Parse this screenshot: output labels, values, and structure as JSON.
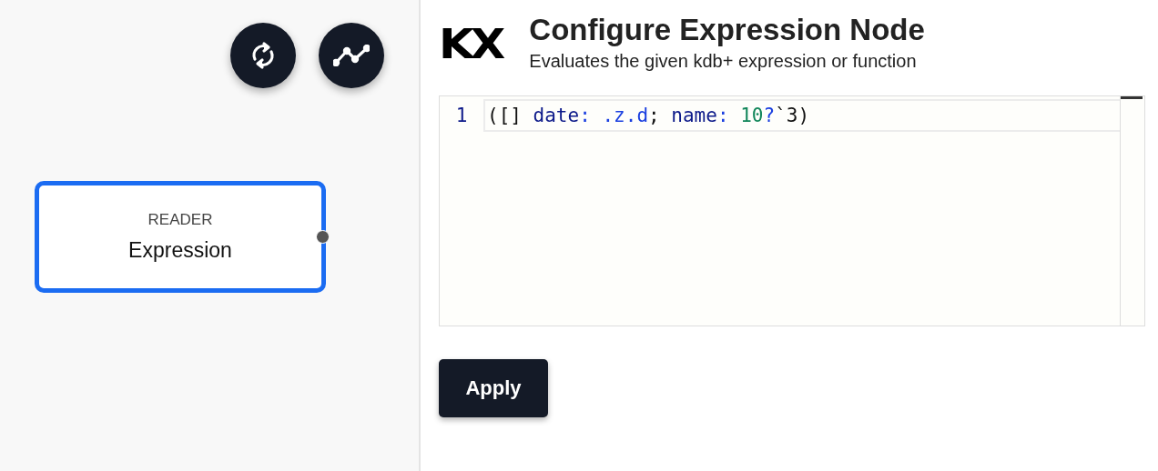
{
  "canvas": {
    "toolbar": [
      {
        "kind": "refresh"
      },
      {
        "kind": "chart"
      }
    ],
    "node": {
      "category": "READER",
      "name": "Expression",
      "selected": true
    }
  },
  "panel": {
    "logo": "KX",
    "title": "Configure Expression Node",
    "subtitle": "Evaluates the given kdb+ expression or function",
    "editor": {
      "lines": [
        {
          "number": "1",
          "tokens": [
            {
              "kind": "plain",
              "text": "([] "
            },
            {
              "kind": "keyword",
              "text": "date"
            },
            {
              "kind": "operator",
              "text": ": "
            },
            {
              "kind": "builtin",
              "text": ".z.d"
            },
            {
              "kind": "plain",
              "text": "; "
            },
            {
              "kind": "keyword",
              "text": "name"
            },
            {
              "kind": "operator",
              "text": ": "
            },
            {
              "kind": "number",
              "text": "10"
            },
            {
              "kind": "operator",
              "text": "?"
            },
            {
              "kind": "plain",
              "text": "`3)"
            }
          ]
        }
      ]
    },
    "apply_button": "Apply"
  }
}
